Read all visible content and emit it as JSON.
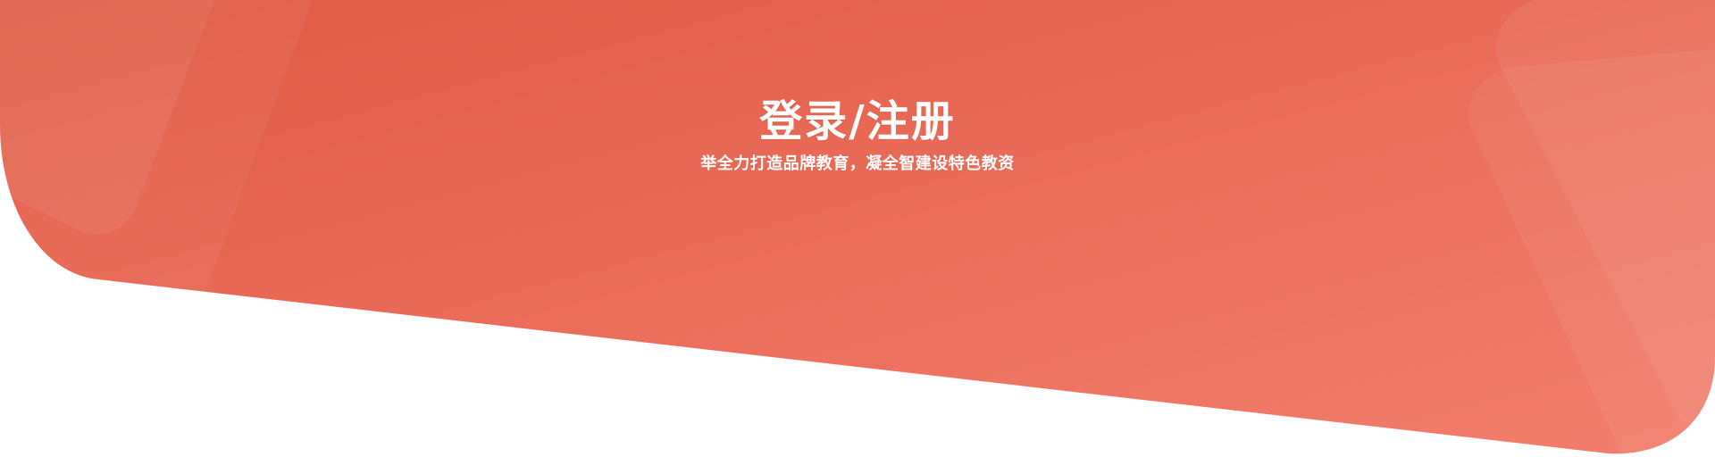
{
  "hero": {
    "title": "登录/注册",
    "subtitle": "举全力打造品牌教育，凝全智建设特色教资"
  },
  "colors": {
    "gradient_start": "#e05a44",
    "gradient_end": "#f37e6d",
    "text": "#ffffff",
    "page_background": "#ffffff"
  }
}
